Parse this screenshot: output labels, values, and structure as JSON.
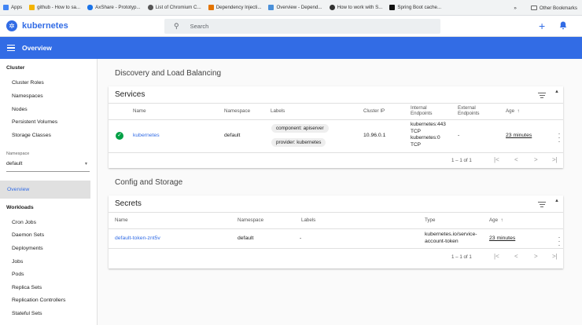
{
  "bookmarks": {
    "items": [
      {
        "label": "Apps",
        "color": "#4285f4"
      },
      {
        "label": "github - How to sa...",
        "color": "#f4b400"
      },
      {
        "label": "AxShare - Prototyp...",
        "color": "#1a73e8"
      },
      {
        "label": "List of Chromium C...",
        "color": "#555555"
      },
      {
        "label": "Dependency Injecti...",
        "color": "#e37400"
      },
      {
        "label": "Overview - Depend...",
        "color": "#4a90d9"
      },
      {
        "label": "How to work with S...",
        "color": "#333333"
      },
      {
        "label": "Spring Boot cache...",
        "color": "#111111"
      }
    ],
    "more": "»",
    "other": "Other Bookmarks"
  },
  "topbar": {
    "app_name": "kubernetes",
    "search_placeholder": "Search",
    "add_symbol": "+"
  },
  "header": {
    "title": "Overview"
  },
  "sidebar": {
    "cluster_heading": "Cluster",
    "cluster_items": [
      "Cluster Roles",
      "Namespaces",
      "Nodes",
      "Persistent Volumes",
      "Storage Classes"
    ],
    "namespace_label": "Namespace",
    "namespace_value": "default",
    "active_item": "Overview",
    "workloads_heading": "Workloads",
    "workload_items": [
      "Cron Jobs",
      "Daemon Sets",
      "Deployments",
      "Jobs",
      "Pods",
      "Replica Sets",
      "Replication Controllers",
      "Stateful Sets"
    ]
  },
  "discovery": {
    "section_title": "Discovery and Load Balancing",
    "card_title": "Services",
    "columns": {
      "name": "Name",
      "namespace": "Namespace",
      "labels": "Labels",
      "cluster_ip": "Cluster IP",
      "internal_1": "Internal",
      "internal_2": "Endpoints",
      "external_1": "External",
      "external_2": "Endpoints",
      "age": "Age",
      "sort": "↑"
    },
    "row": {
      "name": "kubernetes",
      "namespace": "default",
      "label_1": "component: apiserver",
      "label_2": "provider: kubernetes",
      "cluster_ip": "10.96.0.1",
      "int_1a": "kubernetes:443",
      "int_1b": "TCP",
      "int_2a": "kubernetes:0",
      "int_2b": "TCP",
      "external": "-",
      "age": "23 minutes"
    },
    "pager": "1 – 1 of 1"
  },
  "config": {
    "section_title": "Config and Storage",
    "card_title": "Secrets",
    "columns": {
      "name": "Name",
      "namespace": "Namespace",
      "labels": "Labels",
      "type": "Type",
      "age": "Age",
      "sort": "↑"
    },
    "row": {
      "name": "default-token-znt5v",
      "namespace": "default",
      "labels": "-",
      "type_1": "kubernetes.io/service-",
      "type_2": "account-token",
      "age": "23 minutes"
    },
    "pager": "1 – 1 of 1"
  },
  "pager_icons": {
    "first": "|<",
    "prev": "<",
    "next": ">",
    "last": ">|"
  },
  "colors": {
    "accent": "#326ce5",
    "success": "#00a045"
  }
}
